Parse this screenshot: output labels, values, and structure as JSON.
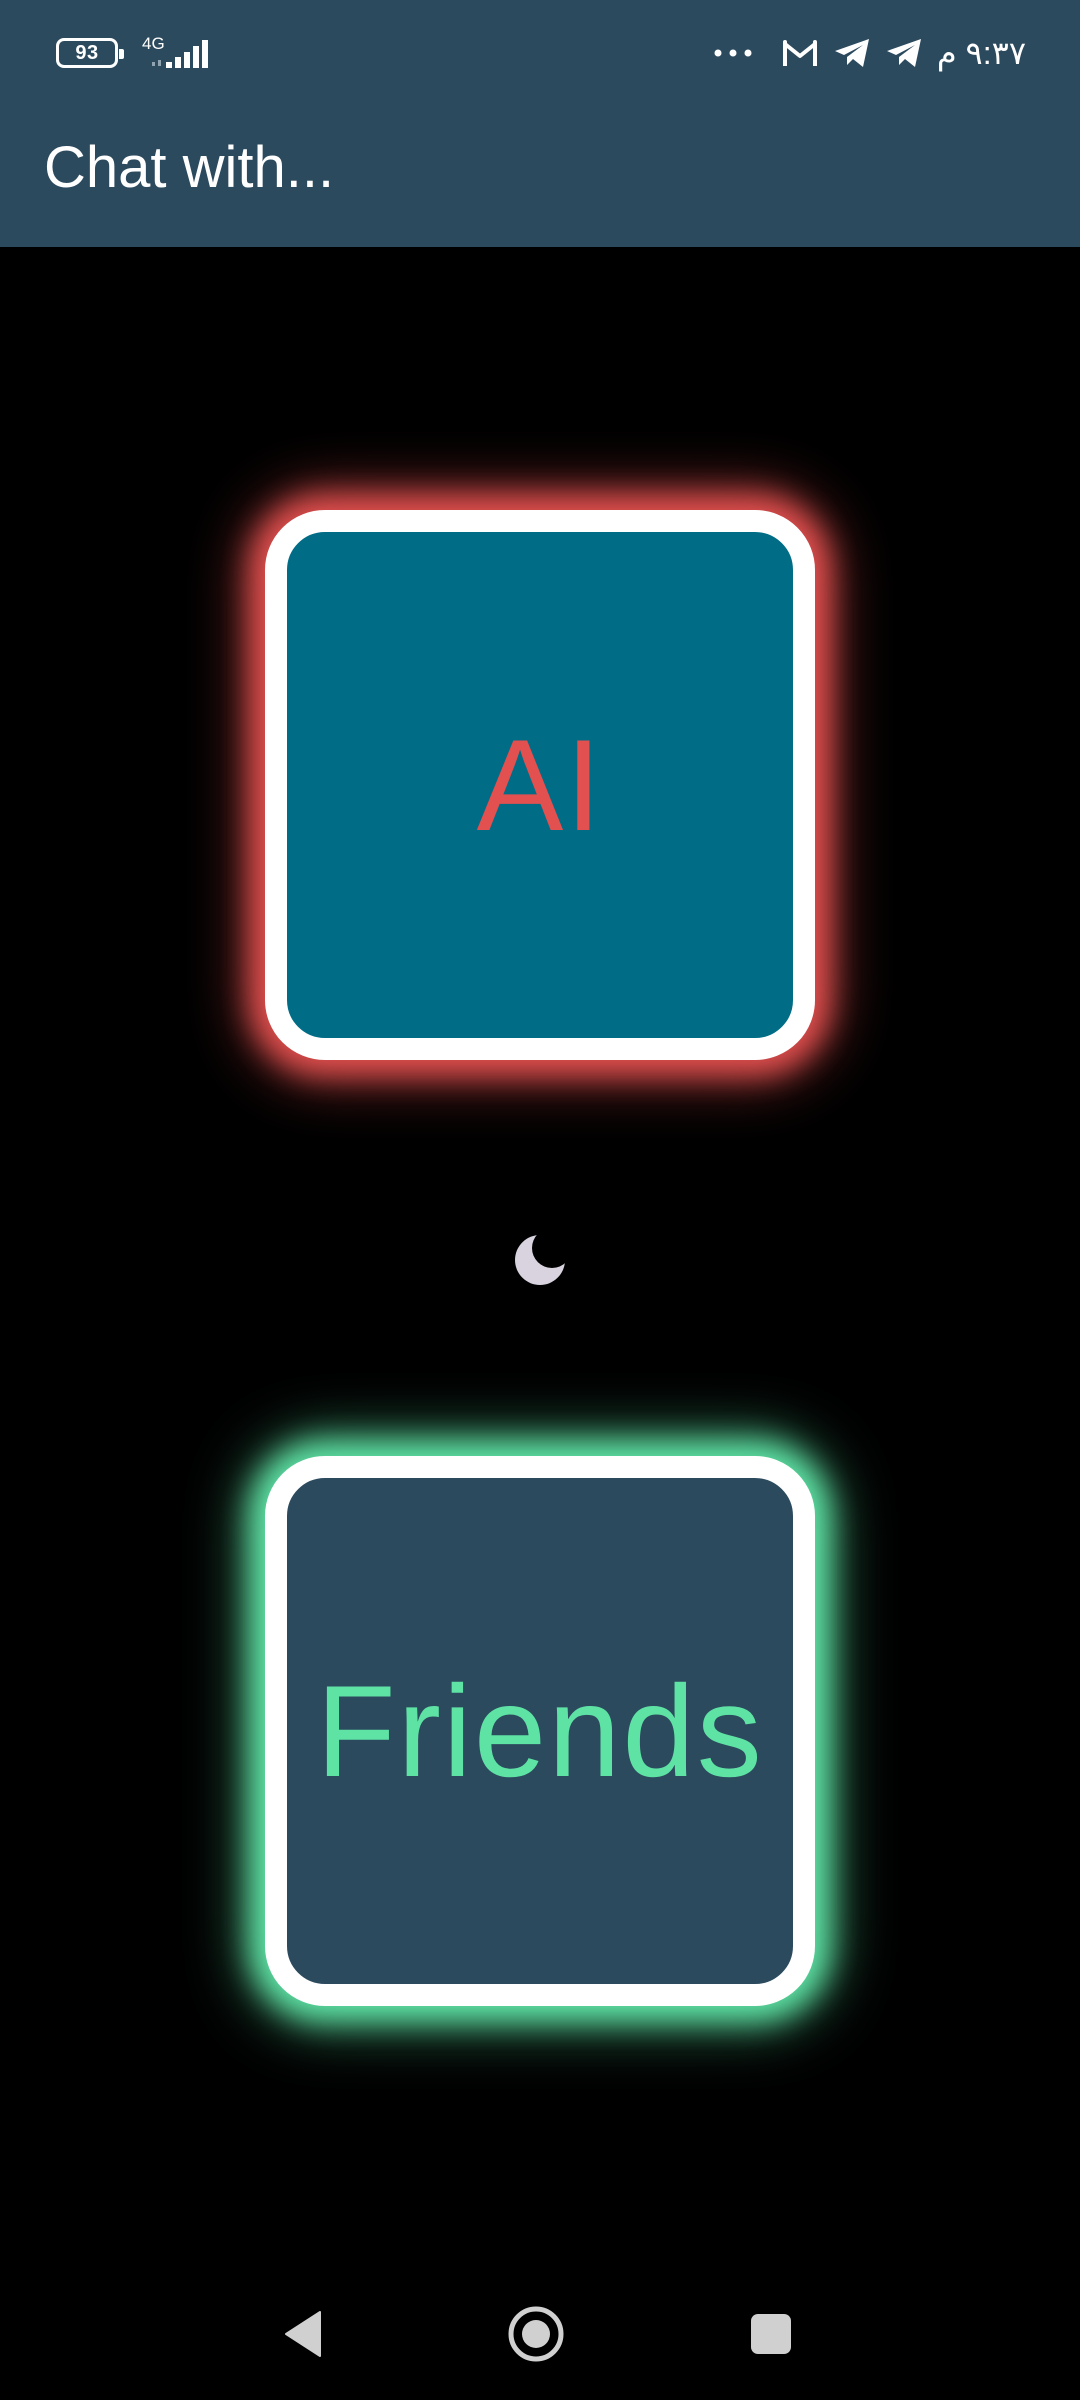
{
  "status_bar": {
    "battery": "93",
    "network": "4G",
    "more": "···",
    "time": "۹:۳۷ م"
  },
  "app_bar": {
    "title": "Chat with..."
  },
  "choices": {
    "ai": "AI",
    "friends": "Friends"
  },
  "icons": {
    "theme_toggle": "moon-icon",
    "notifications": [
      "gmail-icon",
      "telegram-icon",
      "telegram-icon"
    ],
    "nav": [
      "back-icon",
      "home-icon",
      "recents-icon"
    ]
  },
  "colors": {
    "app_bar": "#2c4a5e",
    "background": "#000000",
    "ai_fill": "#006c86",
    "ai_accent": "#e2504f",
    "friends_fill": "#2c4a5e",
    "friends_accent": "#5fe3a5",
    "moon": "#d9d2df"
  }
}
